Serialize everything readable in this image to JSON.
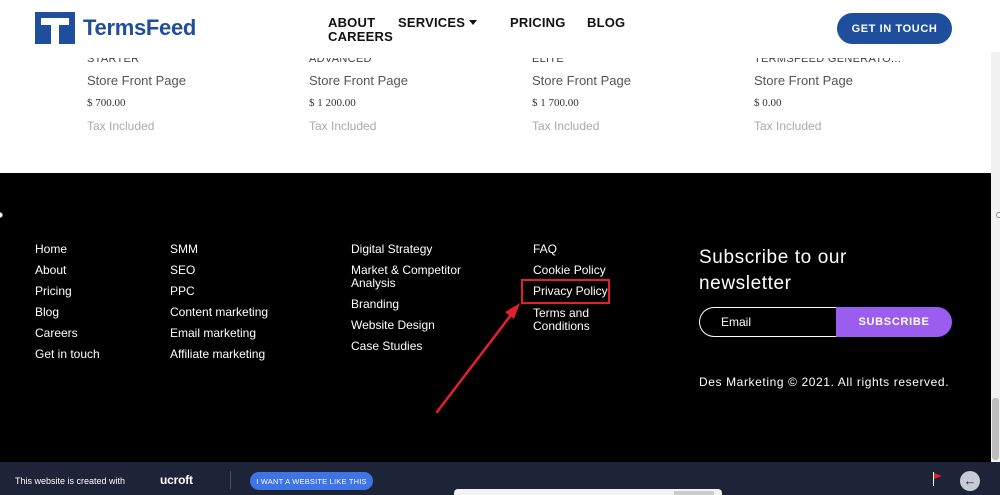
{
  "header": {
    "logo_text": "TermsFeed",
    "nav": [
      "ABOUT",
      "SERVICES",
      "PRICING",
      "BLOG",
      "CAREERS"
    ],
    "cta_label": "GET IN TOUCH"
  },
  "plans": [
    {
      "name": "STARTER",
      "type": "Store Front Page",
      "price": "$ 700.00",
      "tax": "Tax Included"
    },
    {
      "name": "ADVANCED",
      "type": "Store Front Page",
      "price": "$ 1 200.00",
      "tax": "Tax Included"
    },
    {
      "name": "ELITE",
      "type": "Store Front Page",
      "price": "$ 1 700.00",
      "tax": "Tax Included"
    },
    {
      "name": "TERMSFEED GENERATO...",
      "type": "Store Front Page",
      "price": "$ 0.00",
      "tax": "Tax Included"
    }
  ],
  "footer": {
    "col1": [
      "Home",
      "About",
      "Pricing",
      "Blog",
      "Careers",
      "Get in touch"
    ],
    "col2": [
      "SMM",
      "SEO",
      "PPC",
      "Content marketing",
      "Email marketing",
      "Affiliate marketing"
    ],
    "col3": [
      "Digital Strategy",
      "Market & Competitor Analysis",
      "Branding",
      "Website Design",
      "Case Studies"
    ],
    "col4": [
      "FAQ",
      "Cookie Policy",
      "Privacy Policy",
      "Terms and Conditions"
    ],
    "newsletter_title": "Subscribe to our newsletter",
    "email_placeholder": "Email",
    "subscribe_label": "SUBSCRIBE",
    "copyright": "Des Marketing © 2021. All rights reserved.",
    "annotation_color": "#e3202b"
  },
  "bottombar": {
    "text": "This website is created with",
    "brand": "ucroft",
    "button_label": "I WANT A WEBSITE LIKE THIS"
  },
  "icons": [
    "flag-icon",
    "back-arrow-icon",
    "caret-down-icon"
  ]
}
